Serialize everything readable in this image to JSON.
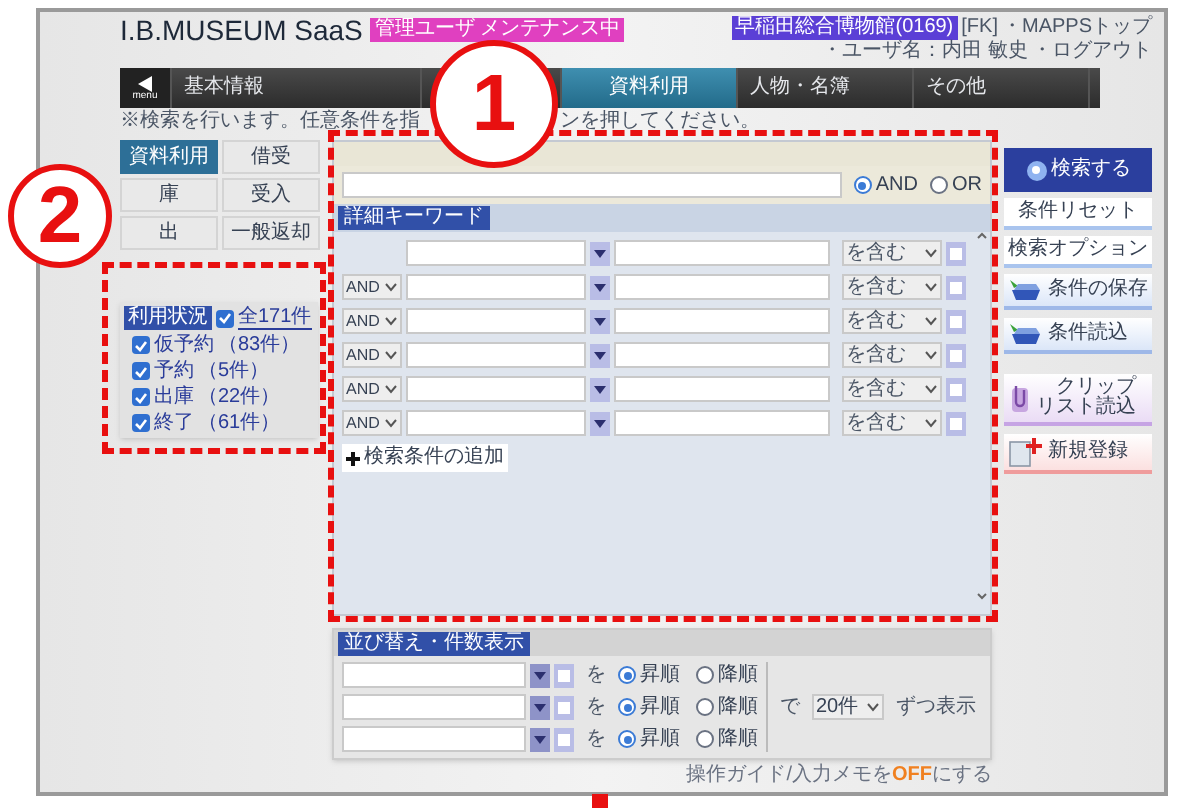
{
  "header": {
    "logo": "I.B.MUSEUM SaaS",
    "mode_badge": "管理ユーザ メンテナンス中",
    "museum_badge": "早稲田総合博物館(0169)",
    "links": [
      "[FK]",
      "・MAPPSトップ",
      "・ユーザ名：内田 敏史",
      "・ログアウト"
    ]
  },
  "nav": {
    "menu_label": "menu",
    "tabs": [
      {
        "label": "基本情報",
        "selected": false
      },
      {
        "label": "資料利用",
        "selected": true
      },
      {
        "label": "人物・名簿",
        "selected": false
      },
      {
        "label": "その他",
        "selected": false
      }
    ]
  },
  "notice": [
    "※検索を行います。任意条件を指",
    "ンを押してください。"
  ],
  "function_buttons": [
    {
      "label": "資料利用",
      "selected": true
    },
    {
      "label": "借受",
      "selected": false
    },
    {
      "label": "庫",
      "selected": false
    },
    {
      "label": "受入",
      "selected": false
    },
    {
      "label": "出",
      "selected": false
    },
    {
      "label": "一般返却",
      "selected": false
    }
  ],
  "usage": {
    "label": "利用状況",
    "all": {
      "label": "全171件",
      "checked": true
    },
    "items": [
      {
        "label": "仮予約",
        "count": "（83件）",
        "checked": true
      },
      {
        "label": "予約",
        "count": "（5件）",
        "checked": true
      },
      {
        "label": "出庫",
        "count": "（22件）",
        "checked": true
      },
      {
        "label": "終了",
        "count": "（61件）",
        "checked": true
      }
    ]
  },
  "search": {
    "operators": [
      {
        "label": "AND",
        "selected": true
      },
      {
        "label": "OR",
        "selected": false
      }
    ],
    "detail_label": "詳細キーワード",
    "rows": [
      {
        "condition": "を含む"
      },
      {
        "operator": "AND",
        "condition": "を含む"
      },
      {
        "operator": "AND",
        "condition": "を含む"
      },
      {
        "operator": "AND",
        "condition": "を含む"
      },
      {
        "operator": "AND",
        "condition": "を含む"
      },
      {
        "operator": "AND",
        "condition": "を含む"
      }
    ],
    "add_button": "検索条件の追加"
  },
  "side_buttons": [
    {
      "lines": [
        "検索する"
      ],
      "kind": "primary"
    },
    {
      "lines": [
        "条件リセット"
      ],
      "kind": "plain"
    },
    {
      "lines": [
        "検索オプション"
      ],
      "kind": "plain"
    },
    {
      "lines": [
        "条件の保存"
      ],
      "kind": "tray"
    },
    {
      "lines": [
        "条件読込"
      ],
      "kind": "tray"
    },
    {
      "lines": [
        "クリップ",
        "リスト読込"
      ],
      "kind": "clip"
    },
    {
      "lines": [
        "新規登録"
      ],
      "kind": "new"
    }
  ],
  "sort": {
    "label": "並び替え・件数表示",
    "rows": [
      {
        "particle": "を",
        "orders": [
          {
            "label": "昇順",
            "selected": true
          },
          {
            "label": "降順",
            "selected": false
          }
        ]
      },
      {
        "particle": "を",
        "orders": [
          {
            "label": "昇順",
            "selected": true
          },
          {
            "label": "降順",
            "selected": false
          }
        ]
      },
      {
        "particle": "を",
        "orders": [
          {
            "label": "昇順",
            "selected": true
          },
          {
            "label": "降順",
            "selected": false
          }
        ]
      }
    ],
    "per_page_prefix": "で",
    "per_page": "20件",
    "per_page_suffix": "ずつ表示"
  },
  "footer_note": [
    "操作ガイド/入力メモを",
    "OFF",
    "にする"
  ],
  "annotations": [
    {
      "label": "1"
    },
    {
      "label": "2"
    }
  ]
}
